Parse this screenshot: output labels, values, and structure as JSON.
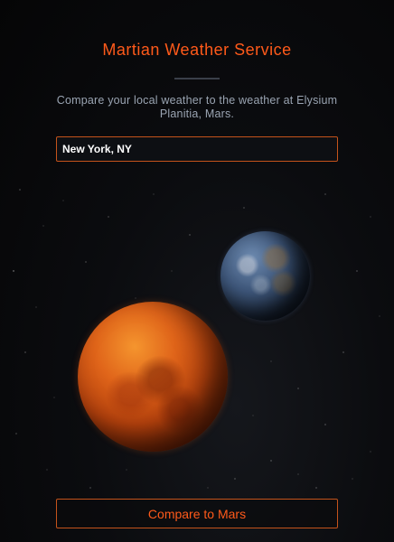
{
  "header": {
    "title": "Martian Weather Service",
    "subtitle": "Compare your local weather to the weather at Elysium Planitia, Mars."
  },
  "location_input": {
    "value": "New York, NY",
    "placeholder": ""
  },
  "actions": {
    "compare_label": "Compare to Mars"
  },
  "illustration": {
    "planets": [
      "earth",
      "mars"
    ]
  },
  "colors": {
    "accent": "#ff5a1a",
    "border": "#c4531b",
    "subtitle": "#9aa4b2",
    "background": "#0b0c0f"
  }
}
